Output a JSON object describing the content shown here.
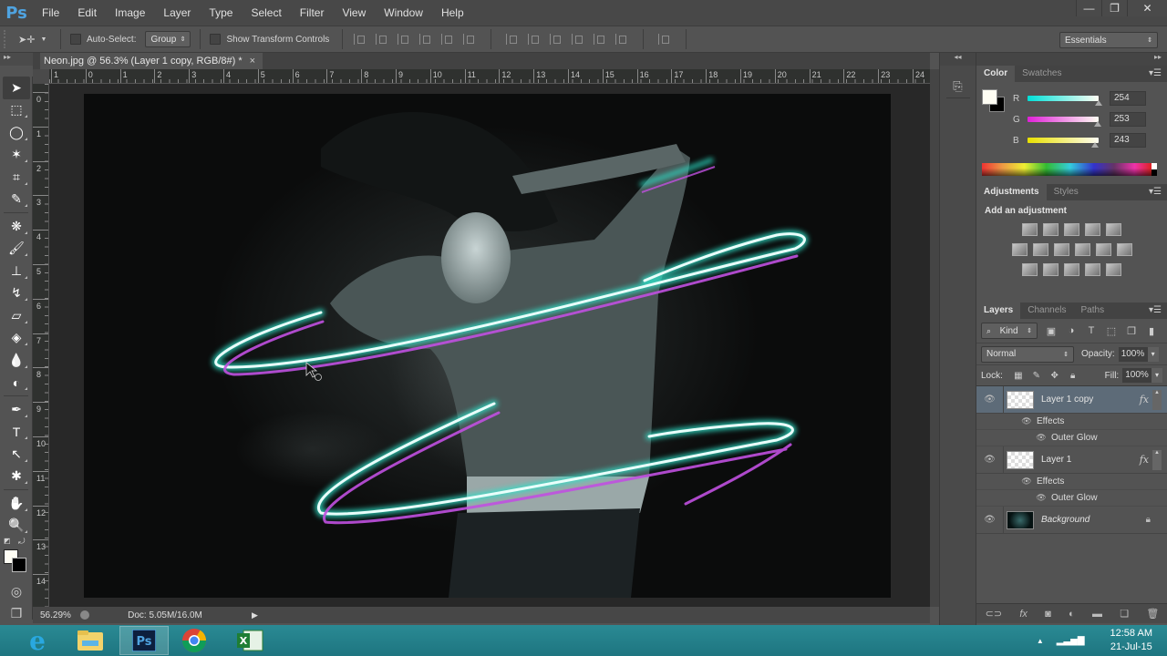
{
  "app": {
    "logo": "Ps",
    "menu": [
      "File",
      "Edit",
      "Image",
      "Layer",
      "Type",
      "Select",
      "Filter",
      "View",
      "Window",
      "Help"
    ],
    "window_controls": {
      "minimize": "—",
      "restore": "❐",
      "close": "✕"
    }
  },
  "options_bar": {
    "auto_select_label": "Auto-Select:",
    "auto_select_checked": false,
    "auto_select_target": "Group",
    "show_transform_label": "Show Transform Controls",
    "show_transform_checked": false,
    "workspace": "Essentials"
  },
  "document": {
    "tab_title": "Neon.jpg @ 56.3% (Layer 1 copy, RGB/8#) *",
    "tab_close": "×",
    "ruler_h": [
      "1",
      "0",
      "1",
      "2",
      "3",
      "4",
      "5",
      "6",
      "7",
      "8",
      "9",
      "10",
      "11",
      "12",
      "13",
      "14",
      "15",
      "16",
      "17",
      "18",
      "19",
      "20",
      "21",
      "22",
      "23",
      "24"
    ],
    "ruler_v": [
      "0",
      "1",
      "2",
      "3",
      "4",
      "5",
      "6",
      "7",
      "8",
      "9",
      "10",
      "11",
      "12",
      "13",
      "14"
    ],
    "status_zoom": "56.29%",
    "status_doc": "Doc: 5.05M/16.0M",
    "status_arrow": "▶"
  },
  "tools": [
    {
      "name": "move-tool",
      "glyph": "➤",
      "active": true
    },
    {
      "name": "marquee-tool",
      "glyph": "⬚"
    },
    {
      "name": "lasso-tool",
      "glyph": "◯"
    },
    {
      "name": "quick-selection-tool",
      "glyph": "✶"
    },
    {
      "name": "crop-tool",
      "glyph": "⌗"
    },
    {
      "name": "eyedropper-tool",
      "glyph": "✎"
    },
    {
      "name": "spot-healing-tool",
      "glyph": "❋"
    },
    {
      "name": "brush-tool",
      "glyph": "🖌"
    },
    {
      "name": "clone-stamp-tool",
      "glyph": "⊥"
    },
    {
      "name": "history-brush-tool",
      "glyph": "↯"
    },
    {
      "name": "eraser-tool",
      "glyph": "▱"
    },
    {
      "name": "paint-bucket-tool",
      "glyph": "◈"
    },
    {
      "name": "blur-tool",
      "glyph": "💧"
    },
    {
      "name": "dodge-tool",
      "glyph": "◐"
    },
    {
      "name": "pen-tool",
      "glyph": "✒"
    },
    {
      "name": "type-tool",
      "glyph": "T"
    },
    {
      "name": "path-selection-tool",
      "glyph": "↖"
    },
    {
      "name": "custom-shape-tool",
      "glyph": "✱"
    },
    {
      "name": "hand-tool",
      "glyph": "✋"
    },
    {
      "name": "zoom-tool",
      "glyph": "🔍"
    }
  ],
  "colors": {
    "foreground": "#fefdf3",
    "background": "#000000"
  },
  "color_panel": {
    "tabs": [
      "Color",
      "Swatches"
    ],
    "active_tab": "Color",
    "channels": [
      {
        "label": "R",
        "value": 254,
        "max": 255,
        "gradient": "linear-gradient(90deg,#00e0d8,#fefdf3)"
      },
      {
        "label": "G",
        "value": 253,
        "max": 255,
        "gradient": "linear-gradient(90deg,#e020d8,#fefdf3)"
      },
      {
        "label": "B",
        "value": 243,
        "max": 255,
        "gradient": "linear-gradient(90deg,#e8e000,#fefdf3)"
      }
    ]
  },
  "adjustments_panel": {
    "tabs": [
      "Adjustments",
      "Styles"
    ],
    "title": "Add an adjustment",
    "rows": [
      [
        "brightness-contrast",
        "levels",
        "curves",
        "exposure",
        "vibrance"
      ],
      [
        "hue-saturation",
        "color-balance",
        "black-white",
        "photo-filter",
        "channel-mixer",
        "color-lookup"
      ],
      [
        "invert",
        "posterize",
        "threshold",
        "selective-color",
        "gradient-map"
      ]
    ]
  },
  "layers_panel": {
    "tabs": [
      "Layers",
      "Channels",
      "Paths"
    ],
    "filter_kind": "Kind",
    "blend_mode": "Normal",
    "opacity_label": "Opacity:",
    "opacity": "100%",
    "lock_label": "Lock:",
    "fill_label": "Fill:",
    "fill": "100%",
    "layers": [
      {
        "name": "Layer 1 copy",
        "selected": true,
        "fx": "fx",
        "effects_label": "Effects",
        "effects": [
          "Outer Glow"
        ]
      },
      {
        "name": "Layer 1",
        "selected": false,
        "fx": "fx",
        "effects_label": "Effects",
        "effects": [
          "Outer Glow"
        ]
      },
      {
        "name": "Background",
        "selected": false,
        "locked": true
      }
    ]
  },
  "taskbar": {
    "apps": [
      "internet-explorer",
      "file-explorer",
      "photoshop",
      "chrome",
      "excel"
    ],
    "active_app": "photoshop",
    "time": "12:58 AM",
    "date": "21-Jul-15"
  }
}
